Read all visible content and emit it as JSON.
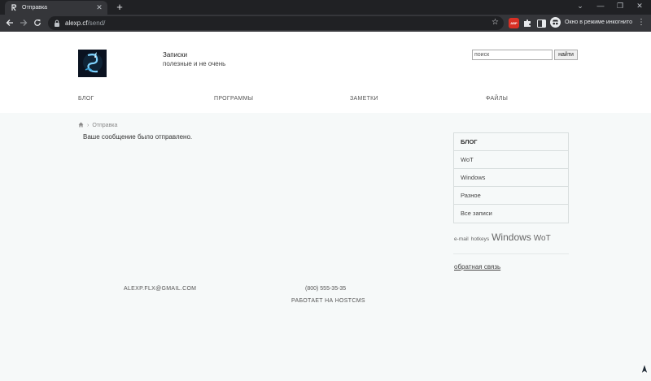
{
  "browser": {
    "tab_title": "Отправка",
    "url_host": "alexp.cf",
    "url_path": "/send/",
    "incognito_label": "Окно в режиме инкогнито",
    "adblock_badge": "ABP"
  },
  "header": {
    "site_title": "Записки",
    "tagline": "полезные и не очень",
    "search_placeholder": "поиск",
    "search_button": "найти"
  },
  "nav": [
    {
      "label": "Блог"
    },
    {
      "label": "Программы"
    },
    {
      "label": "Заметки"
    },
    {
      "label": "Файлы"
    }
  ],
  "breadcrumb": {
    "home_icon": "home-icon",
    "current": "Отправка"
  },
  "content": {
    "message": "Ваше сообщение было отправлено."
  },
  "sidebar": {
    "heading": "Блог",
    "items": [
      {
        "label": "WoT"
      },
      {
        "label": "Windows"
      },
      {
        "label": "Разное"
      },
      {
        "label": "Все записи"
      }
    ]
  },
  "tags": [
    {
      "label": "e-mail"
    },
    {
      "label": "hotkeys"
    },
    {
      "label": "Windows"
    },
    {
      "label": "WoT"
    }
  ],
  "feedback_link": "обратная связь",
  "footer": {
    "email": "ALEXP.FLX@GMAIL.COM",
    "phone": "(800) 555-35-35",
    "powered_by": "РАБОТАЕТ НА HOSTCMS"
  }
}
